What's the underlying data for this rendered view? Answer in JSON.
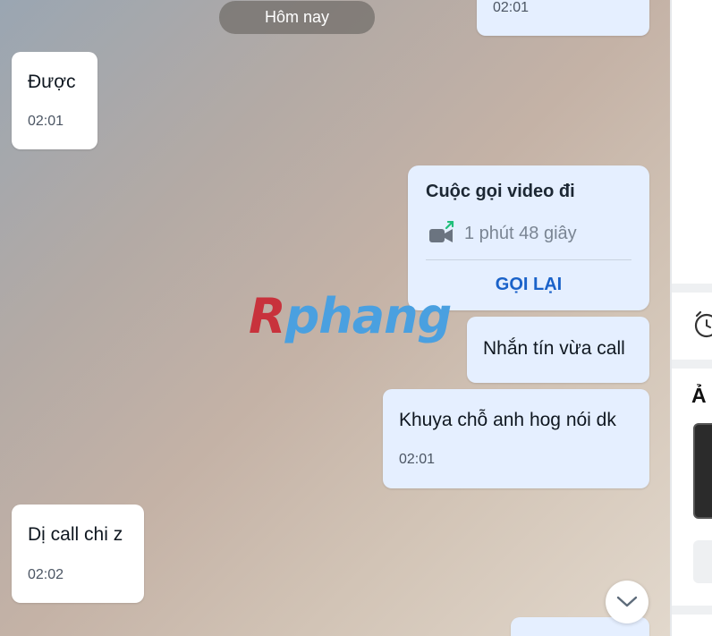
{
  "chat": {
    "top_partial_time": "02:01",
    "day_separator": "Hôm nay",
    "messages": [
      {
        "text": "Được",
        "time": "02:01"
      },
      {
        "text": "Nhắn tín vừa call"
      },
      {
        "text": "Khuya chỗ anh hog nói dk",
        "time": "02:01"
      },
      {
        "text": "Dị call chi z",
        "time": "02:02"
      }
    ],
    "call_card": {
      "title": "Cuộc gọi video đi",
      "duration": "1 phút 48 giây",
      "action_label": "GỌI LẠI"
    },
    "watermark": {
      "first": "R",
      "rest": "phang"
    }
  },
  "right_panel": {
    "title_partial": "Ả"
  },
  "colors": {
    "incoming_bubble": "#ffffff",
    "outgoing_bubble": "#e5efff",
    "accent": "#1a62c9"
  },
  "icons": [
    "video-call-outgoing-icon",
    "chevron-down-icon",
    "alarm-clock-icon"
  ]
}
